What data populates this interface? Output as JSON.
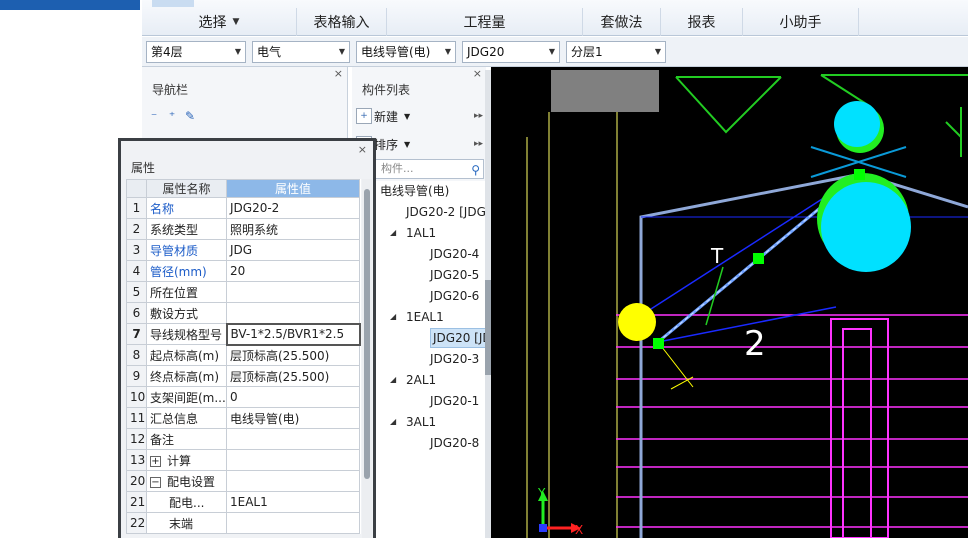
{
  "menu": {
    "items": [
      {
        "label": "选择",
        "dropdown": true
      },
      {
        "label": "表格输入"
      },
      {
        "label": "工程量"
      },
      {
        "label": "套做法"
      },
      {
        "label": "报表"
      },
      {
        "label": "小助手"
      }
    ]
  },
  "selectors": {
    "floor": "第4层",
    "discipline": "电气",
    "category": "电线导管(电)",
    "type": "JDG20",
    "layer": "分层1"
  },
  "nav": {
    "title": "导航栏",
    "close": "×"
  },
  "components": {
    "title": "构件列表",
    "new_label": "新建",
    "sort_label": "排序",
    "search_placeholder": "构件...",
    "close": "×",
    "tree": [
      {
        "label": "电线导管(电)",
        "level": 0
      },
      {
        "label": "JDG20-2 [JDG",
        "level": 1
      },
      {
        "label": "1AL1",
        "level": 1,
        "expanded": true
      },
      {
        "label": "JDG20-4",
        "level": 2
      },
      {
        "label": "JDG20-5",
        "level": 2
      },
      {
        "label": "JDG20-6",
        "level": 2
      },
      {
        "label": "1EAL1",
        "level": 1,
        "expanded": true
      },
      {
        "label": "JDG20 [JD",
        "level": 2,
        "selected": true
      },
      {
        "label": "JDG20-3",
        "level": 2
      },
      {
        "label": "2AL1",
        "level": 1,
        "expanded": true
      },
      {
        "label": "JDG20-1",
        "level": 2
      },
      {
        "label": "3AL1",
        "level": 1,
        "expanded": true
      },
      {
        "label": "JDG20-8",
        "level": 2
      }
    ]
  },
  "properties": {
    "title": "属性",
    "close": "×",
    "col_name": "属性名称",
    "col_value": "属性值",
    "rows": [
      {
        "num": "1",
        "name": "名称",
        "value": "JDG20-2",
        "blue": true
      },
      {
        "num": "2",
        "name": "系统类型",
        "value": "照明系统"
      },
      {
        "num": "3",
        "name": "导管材质",
        "value": "JDG",
        "blue": true
      },
      {
        "num": "4",
        "name": "管径(mm)",
        "value": "20",
        "blue": true
      },
      {
        "num": "5",
        "name": "所在位置",
        "value": ""
      },
      {
        "num": "6",
        "name": "敷设方式",
        "value": ""
      },
      {
        "num": "7",
        "name": "导线规格型号",
        "value": "BV-1*2.5/BVR1*2.5",
        "active": true
      },
      {
        "num": "8",
        "name": "起点标高(m)",
        "value": "层顶标高(25.500)"
      },
      {
        "num": "9",
        "name": "终点标高(m)",
        "value": "层顶标高(25.500)"
      },
      {
        "num": "10",
        "name": "支架间距(m...",
        "value": "0"
      },
      {
        "num": "11",
        "name": "汇总信息",
        "value": "电线导管(电)"
      },
      {
        "num": "12",
        "name": "备注",
        "value": ""
      },
      {
        "num": "13",
        "name": "计算",
        "value": "",
        "group": "+"
      },
      {
        "num": "20",
        "name": "配电设置",
        "value": "",
        "group": "−"
      },
      {
        "num": "21",
        "name": "配电...",
        "value": "1EAL1",
        "indent": true
      },
      {
        "num": "22",
        "name": "末端",
        "value": "",
        "indent": true
      }
    ]
  },
  "canvas": {
    "axis_x": "X",
    "axis_y": "Y",
    "label_T": "T",
    "label_2": "2"
  },
  "colors": {
    "accent": "#1d5fb0",
    "canvas_bg": "#000000",
    "grid_yellow": "#ffff00",
    "wall_magenta": "#ff00ff",
    "pipe_blue": "#7fa9ff",
    "node_green": "#00ff00",
    "fixture_cyan": "#00e5ff"
  }
}
